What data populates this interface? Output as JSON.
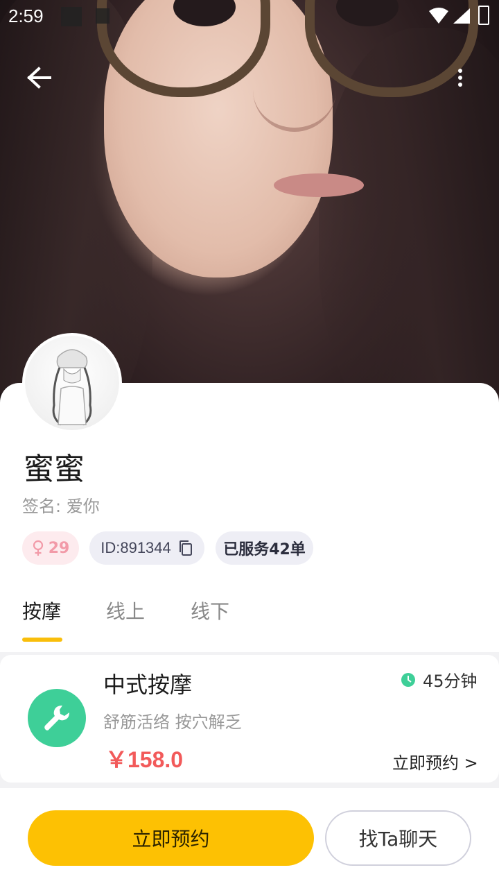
{
  "status_bar": {
    "time": "2:59"
  },
  "header": {
    "back_icon": "arrow-left-icon",
    "more_icon": "more-vertical-icon"
  },
  "profile": {
    "name": "蜜蜜",
    "signature": "签名: 爱你",
    "gender_icon": "female-icon",
    "age": "29",
    "id_text": "ID:891344",
    "copy_icon": "copy-icon",
    "served_text": "已服务42单"
  },
  "tabs": [
    {
      "label": "按摩",
      "active": true
    },
    {
      "label": "线上",
      "active": false
    },
    {
      "label": "线下",
      "active": false
    }
  ],
  "service": {
    "icon": "wrench-icon",
    "title": "中式按摩",
    "description": "舒筋活络 按穴解乏",
    "price": "￥158.0",
    "duration": "45分钟",
    "book_link": "立即预约 >"
  },
  "actions": {
    "book_label": "立即预约",
    "chat_label": "找Ta聊天"
  },
  "colors": {
    "accent_yellow": "#fdc103",
    "price_red": "#f25a5a",
    "service_green": "#3ecf98",
    "gender_pink": "#f29aa8"
  }
}
